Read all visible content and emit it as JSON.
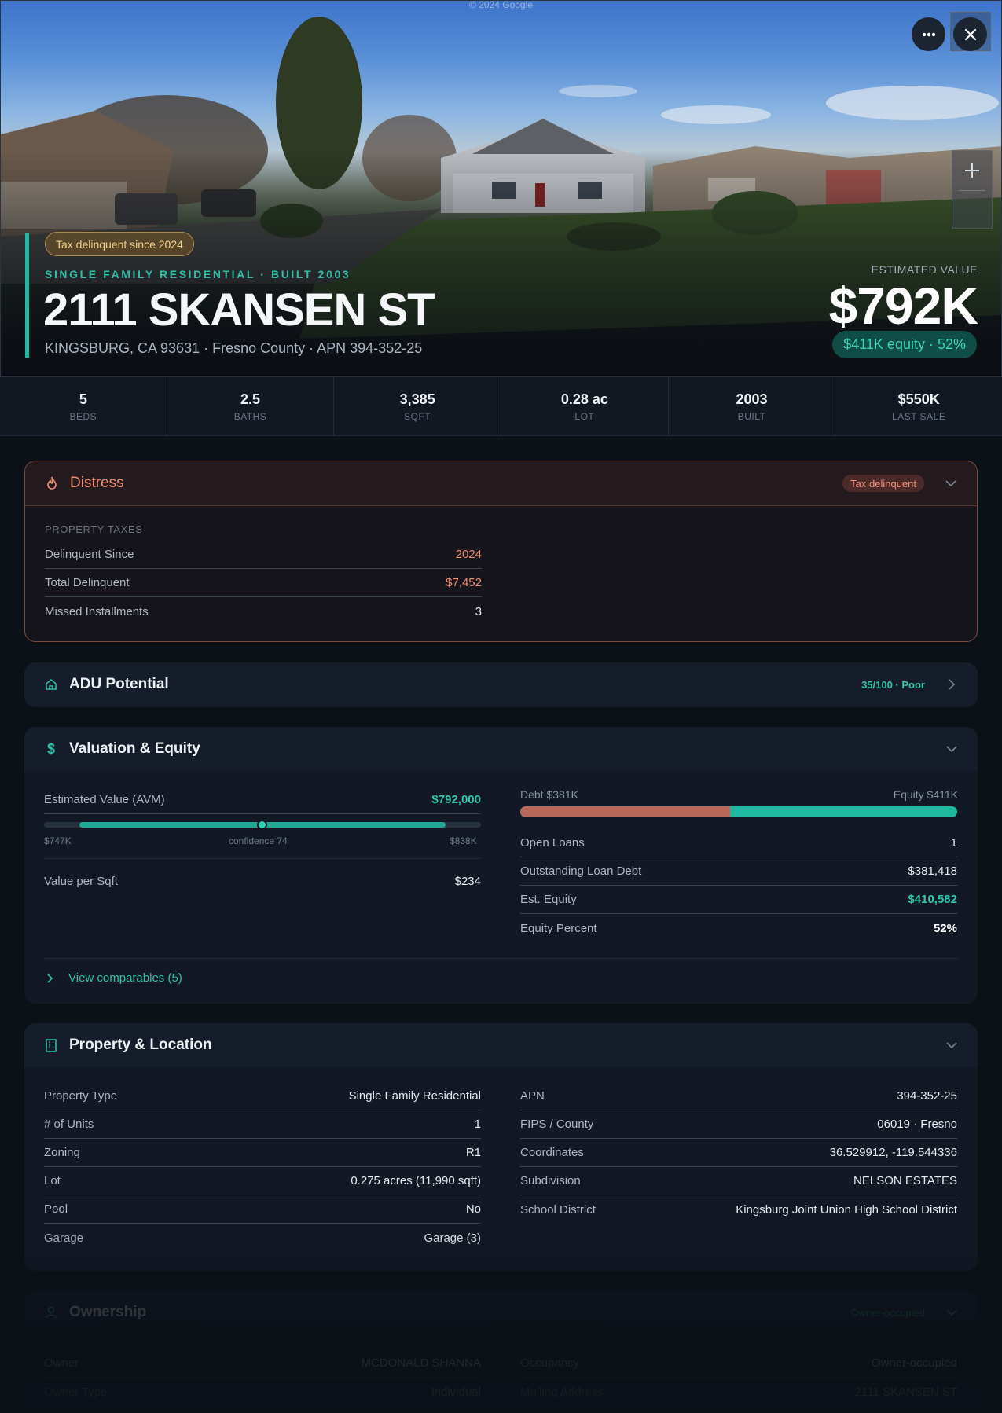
{
  "hero": {
    "copyright": "© 2024 Google",
    "tag": "Tax delinquent since 2024",
    "subtitle": "SINGLE FAMILY RESIDENTIAL · BUILT 2003",
    "address": "2111 SKANSEN ST",
    "location": "KINGSBURG, CA 93631 · Fresno County · APN 394-352-25",
    "estimated_label": "ESTIMATED VALUE",
    "estimated_value": "$792K",
    "equity_pill": "$411K equity · 52%",
    "icons": {
      "more": "more-icon",
      "close": "close-icon",
      "zoom_in": "plus-icon"
    }
  },
  "stats": [
    {
      "value": "5",
      "label": "BEDS"
    },
    {
      "value": "2.5",
      "label": "BATHS"
    },
    {
      "value": "3,385",
      "label": "SQFT"
    },
    {
      "value": "0.28 ac",
      "label": "LOT"
    },
    {
      "value": "2003",
      "label": "BUILT"
    },
    {
      "value": "$550K",
      "label": "LAST SALE"
    }
  ],
  "distress": {
    "title": "Distress",
    "badge": "Tax delinquent",
    "section": "PROPERTY TAXES",
    "rows": [
      {
        "k": "Delinquent Since",
        "v": "2024"
      },
      {
        "k": "Total Delinquent",
        "v": "$7,452"
      },
      {
        "k": "Missed Installments",
        "v": "3"
      }
    ]
  },
  "adu": {
    "title": "ADU Potential",
    "badge": "35/100 · Poor"
  },
  "valuation": {
    "title": "Valuation & Equity",
    "avm_label": "Estimated Value (AVM)",
    "avm_value": "$792,000",
    "range_low": "$747K",
    "range_high": "$838K",
    "confidence": "confidence 74",
    "confidence_score": 74,
    "vps_label": "Value per Sqft",
    "vps_value": "$234",
    "debt_label": "Debt $381K",
    "equity_label": "Equity $411K",
    "debt_fraction": 0.48,
    "rows": [
      {
        "k": "Open Loans",
        "v": "1"
      },
      {
        "k": "Outstanding Loan Debt",
        "v": "$381,418"
      },
      {
        "k": "Est. Equity",
        "v": "$410,582"
      },
      {
        "k": "Equity Percent",
        "v": "52%"
      }
    ],
    "comparables": "View comparables (5)"
  },
  "property": {
    "title": "Property & Location",
    "left": [
      {
        "k": "Property Type",
        "v": "Single Family Residential"
      },
      {
        "k": "# of Units",
        "v": "1"
      },
      {
        "k": "Zoning",
        "v": "R1"
      },
      {
        "k": "Lot",
        "v": "0.275 acres (11,990 sqft)"
      },
      {
        "k": "Pool",
        "v": "No"
      },
      {
        "k": "Garage",
        "v": "Garage (3)"
      }
    ],
    "right": [
      {
        "k": "APN",
        "v": "394-352-25"
      },
      {
        "k": "FIPS / County",
        "v": "06019 · Fresno"
      },
      {
        "k": "Coordinates",
        "v": "36.529912, -119.544336"
      },
      {
        "k": "Subdivision",
        "v": "NELSON ESTATES"
      },
      {
        "k": "School District",
        "v": "Kingsburg Joint Union High School District"
      }
    ]
  },
  "ownership": {
    "title": "Ownership",
    "badge": "Owner-occupied",
    "left": [
      {
        "k": "Owner",
        "v": "MCDONALD SHANNA"
      },
      {
        "k": "Owner Type",
        "v": "Individual"
      }
    ],
    "right": [
      {
        "k": "Occupancy",
        "v": "Owner-occupied"
      },
      {
        "k": "Mailing Address",
        "v": "2111 SKANSEN ST"
      }
    ]
  },
  "colors": {
    "accent": "#1fb8a1",
    "danger": "#ef8b72",
    "debt": "#b8685a",
    "background": "#0c1017"
  }
}
